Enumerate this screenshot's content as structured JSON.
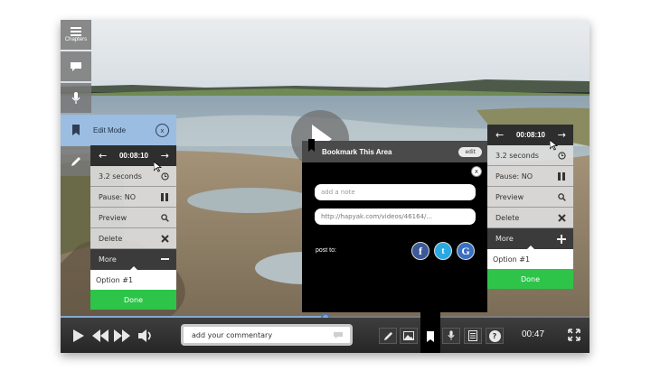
{
  "rail": {
    "chapters_label": "Chapters"
  },
  "left_panel": {
    "title": "Edit Mode",
    "time": "00:08:10",
    "duration": "3.2 seconds",
    "pause": "Pause: NO",
    "preview": "Preview",
    "delete": "Delete",
    "more": "More",
    "option": "Option #1",
    "done": "Done"
  },
  "right_panel": {
    "time": "00:08:10",
    "duration": "3.2 seconds",
    "pause": "Pause: NO",
    "preview": "Preview",
    "delete": "Delete",
    "more": "More",
    "option": "Option #1",
    "done": "Done"
  },
  "bookmark_dialog": {
    "title": "Bookmark This Area",
    "edit_label": "edit",
    "close_label": "x",
    "note_placeholder": "add a note",
    "url_value": "http://hapyak.com/videos/46164/...",
    "post_to_label": "post to:",
    "social": [
      "f",
      "t",
      "G"
    ]
  },
  "controls": {
    "commentary_placeholder": "add your commentary",
    "time": "00:47",
    "progress": 0.5,
    "help_label": "?"
  },
  "colors": {
    "accent_blue": "#86a9d3",
    "done_green": "#2ec44a",
    "facebook": "#3b5998",
    "twitter": "#2aa9e0",
    "google": "#3b6fc2"
  }
}
